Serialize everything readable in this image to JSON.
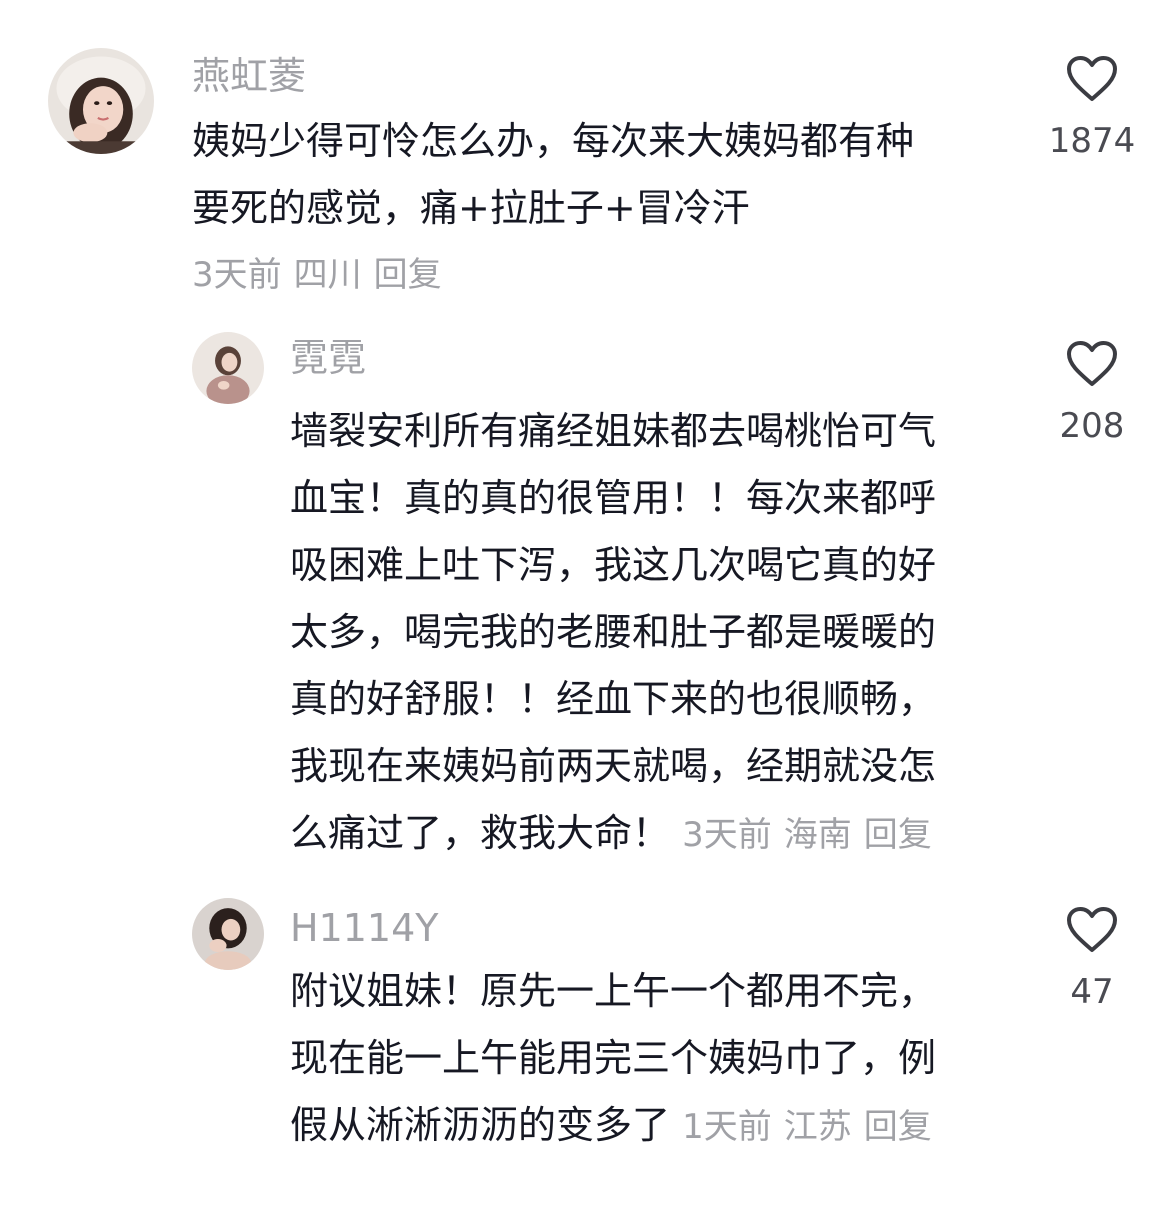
{
  "comments": [
    {
      "username": "燕虹菱",
      "lines": [
        "姨妈少得可怜怎么办，每次来大姨妈都有种",
        "要死的感觉，痛+拉肚子+冒冷汗"
      ],
      "time": "3天前",
      "location": "四川",
      "reply": "回复",
      "likes": "1874"
    },
    {
      "username": "霓霓",
      "lines": [
        "墙裂安利所有痛经姐妹都去喝桃怡可气",
        "血宝！真的真的很管用！！每次来都呼",
        "吸困难上吐下泻，我这几次喝它真的好",
        "太多，喝完我的老腰和肚子都是暖暖的",
        "真的好舒服！！经血下来的也很顺畅，",
        "我现在来姨妈前两天就喝，经期就没怎",
        "么痛过了，救我大命！"
      ],
      "time": "3天前",
      "location": "海南",
      "reply": "回复",
      "likes": "208"
    },
    {
      "username": "H1114Y",
      "lines": [
        "附议姐妹！原先一上午一个都用不完，",
        "现在能一上午能用完三个姨妈巾了，例",
        "假从淅淅沥沥的变多了"
      ],
      "time": "1天前",
      "location": "江苏",
      "reply": "回复",
      "likes": "47"
    }
  ],
  "colors": {
    "text": "#161823",
    "secondary": "#a0a1a6",
    "count": "#4a4b52",
    "icon_stroke": "#3b3c42"
  }
}
